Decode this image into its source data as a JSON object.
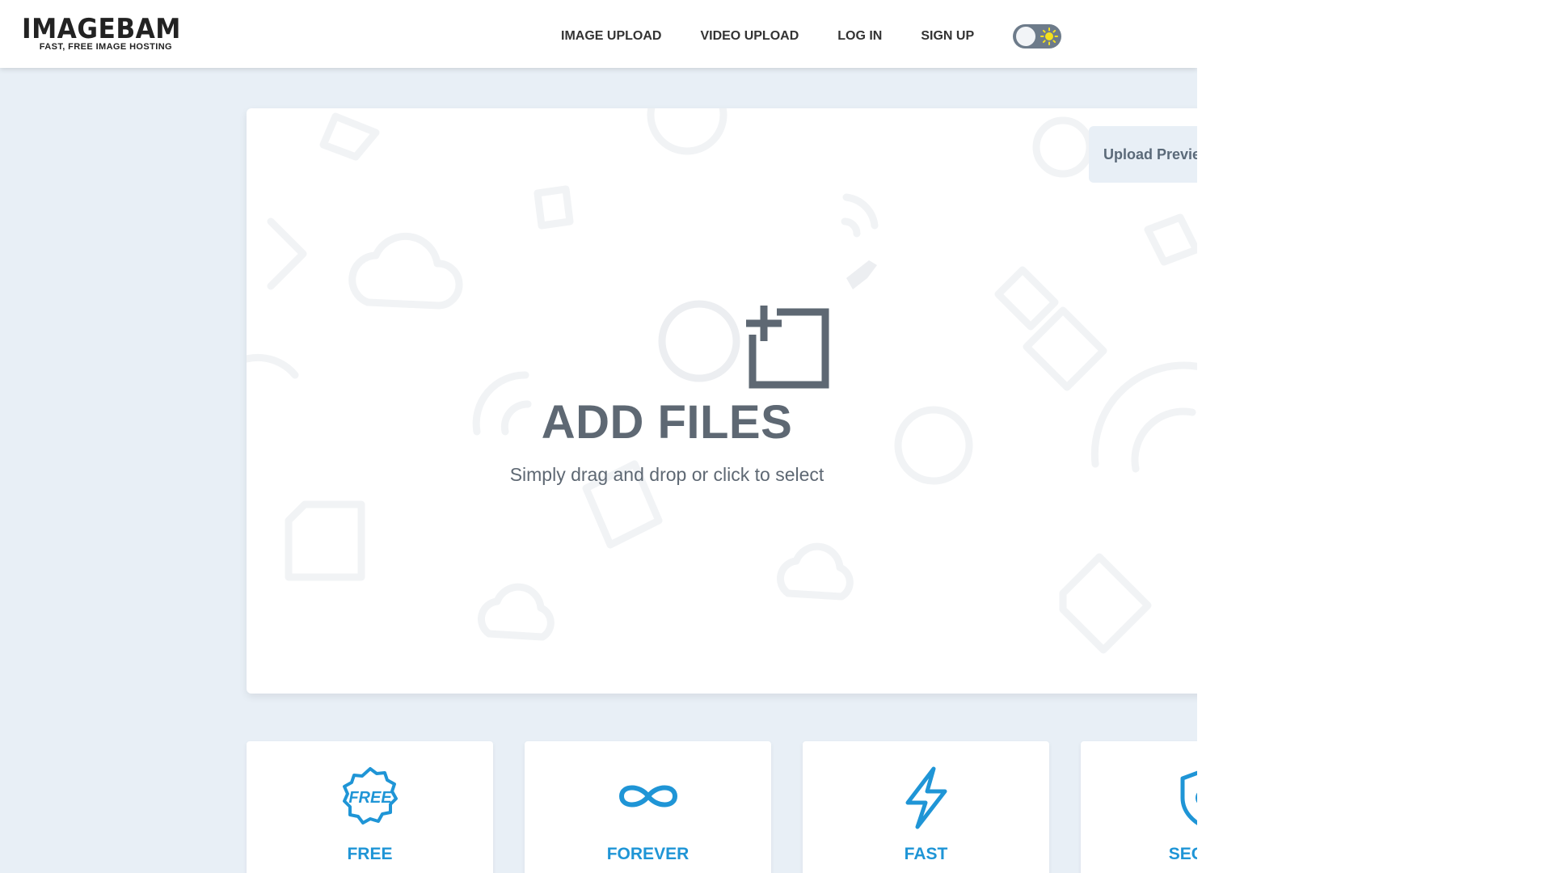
{
  "header": {
    "logo_main": "IMAGEBAM",
    "logo_sub": "FAST, FREE IMAGE HOSTING",
    "nav": [
      {
        "label": "IMAGE UPLOAD"
      },
      {
        "label": "VIDEO UPLOAD"
      },
      {
        "label": "LOG IN"
      },
      {
        "label": "SIGN UP"
      }
    ],
    "theme_toggle": {
      "state": "light",
      "icon": "sun-icon"
    }
  },
  "upload": {
    "preview_button": "Upload Preview",
    "title": "ADD FILES",
    "subtitle": "Simply drag and drop or click to select",
    "icon": "add-image-icon"
  },
  "features": [
    {
      "label": "FREE",
      "icon": "free-badge-icon"
    },
    {
      "label": "FOREVER",
      "icon": "infinity-icon"
    },
    {
      "label": "FAST",
      "icon": "lightning-icon"
    },
    {
      "label": "SECURE",
      "icon": "shield-icon"
    }
  ],
  "colors": {
    "page_bg": "#e8eff6",
    "accent": "#1f95d6",
    "text_dark": "#5e6873",
    "toggle_bg": "#6d7b8a",
    "sun": "#f5e11b"
  }
}
